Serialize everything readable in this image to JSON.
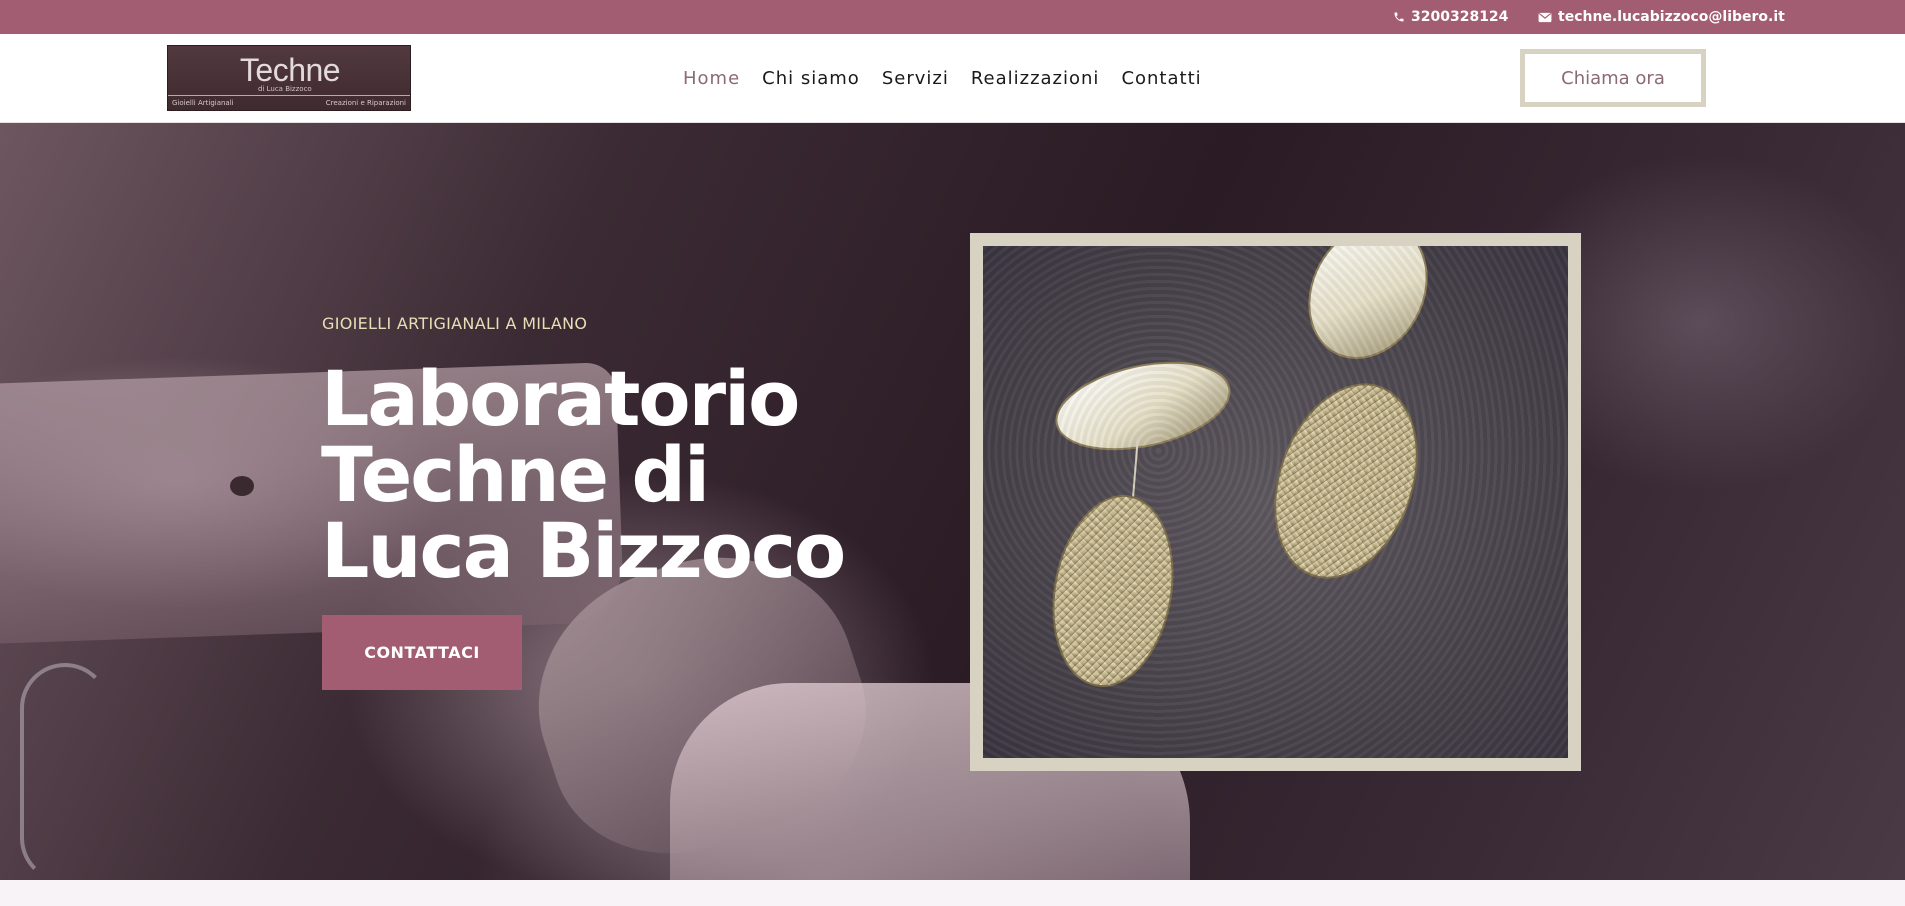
{
  "topbar": {
    "phone": "3200328124",
    "email": "techne.lucabizzoco@libero.it"
  },
  "header": {
    "logo": {
      "wordmark": "Techne",
      "subtitle": "di Luca Bizzoco",
      "left_caption": "Gioielli Artigianali",
      "right_caption": "Creazioni e Riparazioni"
    },
    "nav": [
      {
        "label": "Home",
        "active": true
      },
      {
        "label": "Chi siamo",
        "active": false
      },
      {
        "label": "Servizi",
        "active": false
      },
      {
        "label": "Realizzazioni",
        "active": false
      },
      {
        "label": "Contatti",
        "active": false
      }
    ],
    "cta_label": "Chiama ora"
  },
  "hero": {
    "eyebrow": "GIOIELLI ARTIGIANALI A MILANO",
    "title": "Laboratorio Techne di Luca Bizzoco",
    "button_label": "CONTATTACI"
  },
  "colors": {
    "brand": "#a35d72",
    "frame": "#d7d2c1",
    "nav_active": "#8a6a74",
    "eyebrow": "#e8dfb8"
  },
  "icons": [
    "phone-icon",
    "envelope-icon"
  ]
}
